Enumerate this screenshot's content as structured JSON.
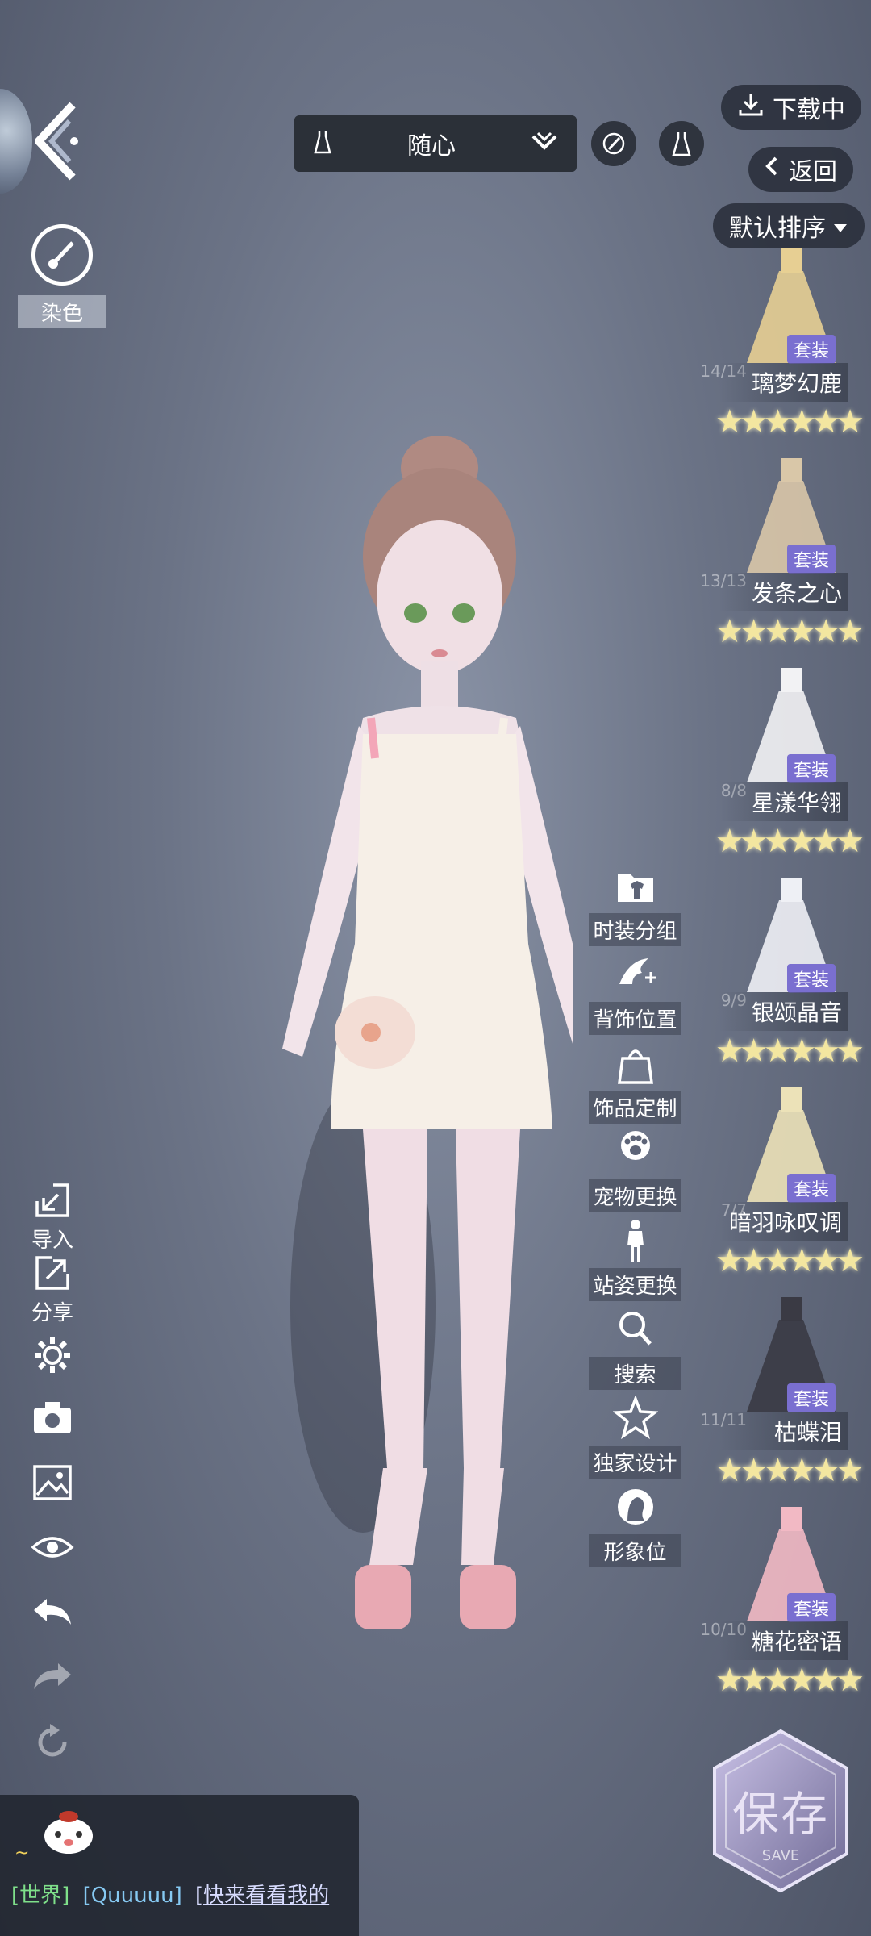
{
  "top": {
    "outfit_filter": "随心",
    "download_label": "下载中",
    "back_label": "返回",
    "sort_label": "默认排序"
  },
  "dye": {
    "label": "染色"
  },
  "outfits": [
    {
      "name": "璃梦幻鹿",
      "tag": "套装",
      "count": "14/14",
      "stars": 6,
      "color": "#e7cf93"
    },
    {
      "name": "发条之心",
      "tag": "套装",
      "count": "13/13",
      "stars": 6,
      "color": "#d9c7a8"
    },
    {
      "name": "星漾华翎",
      "tag": "套装",
      "count": "8/8",
      "stars": 6,
      "color": "#f2f2f4"
    },
    {
      "name": "银颂晶音",
      "tag": "套装",
      "count": "9/9",
      "stars": 6,
      "color": "#eef0f5"
    },
    {
      "name": "暗羽咏叹调",
      "tag": "套装",
      "count": "7/7",
      "stars": 6,
      "color": "#ece2b8"
    },
    {
      "name": "枯蝶泪",
      "tag": "套装",
      "count": "11/11",
      "stars": 6,
      "color": "#3a3a44"
    },
    {
      "name": "糖花密语",
      "tag": "套装",
      "count": "10/10",
      "stars": 6,
      "color": "#f2b9c4"
    }
  ],
  "mid_menu": [
    {
      "label": "时装分组",
      "icon": "folder-shirt-icon"
    },
    {
      "label": "背饰位置",
      "icon": "wing-move-icon"
    },
    {
      "label": "饰品定制",
      "icon": "bag-icon"
    },
    {
      "label": "宠物更换",
      "icon": "paw-icon"
    },
    {
      "label": "站姿更换",
      "icon": "person-icon"
    },
    {
      "label": "搜索",
      "icon": "search-icon"
    },
    {
      "label": "独家设计",
      "icon": "star-icon"
    },
    {
      "label": "形象位",
      "icon": "portrait-icon"
    }
  ],
  "left_tools": {
    "import_label": "导入",
    "share_label": "分享"
  },
  "chat": {
    "channel": "[世界]",
    "user": "[Quuuuu]",
    "message": "[快来看看我的",
    "tilde": "~"
  },
  "save": {
    "label": "保存",
    "sub": "SAVE"
  }
}
